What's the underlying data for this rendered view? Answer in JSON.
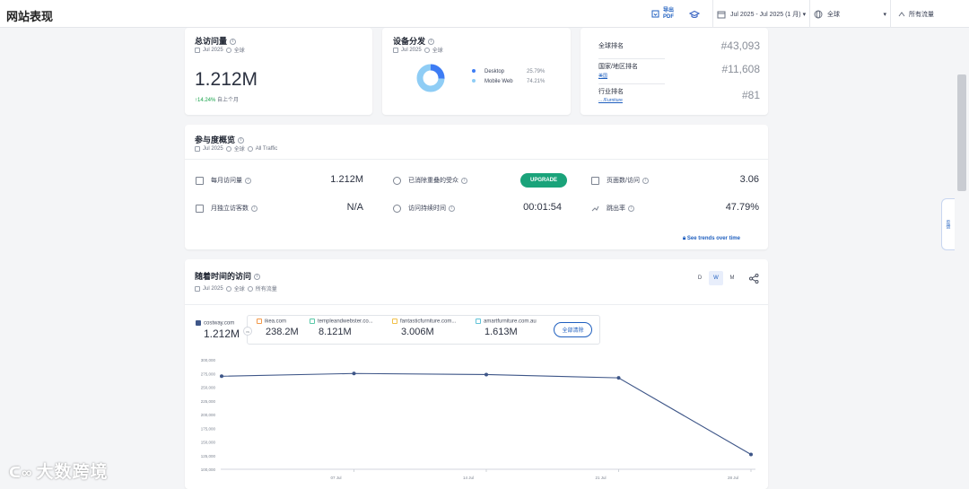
{
  "header": {
    "title": "网站表现",
    "pdf_label_1": "导出",
    "pdf_label_2": "PDF",
    "date_range": "Jul 2025 - Jul 2025 (1 月)",
    "geo": "全球",
    "traffic": "所有流量"
  },
  "visits_card": {
    "title": "总访问量",
    "period": "Jul 2025",
    "region": "全球",
    "value": "1.212M",
    "change": "↑14.24%",
    "change_suffix": "自上个月"
  },
  "device_card": {
    "title": "设备分发",
    "period": "Jul 2025",
    "region": "全球",
    "legend": [
      {
        "label": "Desktop",
        "value": "25.79%",
        "color": "#3d7cf4",
        "share": 25.79
      },
      {
        "label": "Mobile Web",
        "value": "74.21%",
        "color": "#8fcdf5",
        "share": 74.21
      }
    ]
  },
  "rank_card": {
    "global_label": "全球排名",
    "global_value": "#43,093",
    "country_label": "国家/地区排名",
    "country_sub": "美国",
    "country_value": "#11,608",
    "industry_label": "行业排名",
    "industry_sub": "... /Furniture",
    "industry_value": "#81"
  },
  "engagement": {
    "title": "参与度概览",
    "period": "Jul 2025",
    "region": "全球",
    "traffic": "All Traffic",
    "rows": [
      {
        "label": "每月访问量",
        "value": "1.212M"
      },
      {
        "label": "月独立访客数",
        "value": "N/A"
      },
      {
        "label": "已消除重叠的受众",
        "value": "UPGRADE"
      },
      {
        "label": "访问持续时间",
        "value": "00:01:54"
      },
      {
        "label": "页面数/访问",
        "value": "3.06"
      },
      {
        "label": "跳出率",
        "value": "47.79%"
      }
    ],
    "trends_link": "See trends over time"
  },
  "visits_over_time": {
    "title": "随着时间的访问",
    "period": "Jul 2025",
    "region": "全球",
    "traffic": "所有流量",
    "granularity": [
      "D",
      "W",
      "M"
    ],
    "granularity_active": "W",
    "primary": {
      "name": "costway.com",
      "value": "1.212M"
    },
    "vs_label": "vs",
    "competitors": [
      {
        "name": "ikea.com",
        "value": "238.2M",
        "color": "#f2994a"
      },
      {
        "name": "templeandwebster.co...",
        "value": "8.121M",
        "color": "#5ac8a8"
      },
      {
        "name": "fantasticfurniture.com...",
        "value": "3.006M",
        "color": "#f2c14a"
      },
      {
        "name": "amartfurniture.com.au",
        "value": "1.613M",
        "color": "#62c3d8"
      }
    ],
    "clear_all": "全部清除"
  },
  "chart_data": {
    "type": "line",
    "x_ticks": [
      "07 Jul",
      "14 Jul",
      "21 Jul",
      "28 Jul"
    ],
    "y_ticks": [
      "300,000",
      "275,000",
      "250,000",
      "225,000",
      "200,000",
      "175,000",
      "150,000",
      "125,000",
      "100,000"
    ],
    "ylim": [
      100000,
      300000
    ],
    "series": [
      {
        "name": "costway.com",
        "color": "#3e5688",
        "points": [
          {
            "x": "30 Jun",
            "y": 270000
          },
          {
            "x": "07 Jul",
            "y": 275000
          },
          {
            "x": "14 Jul",
            "y": 273000
          },
          {
            "x": "21 Jul",
            "y": 267000
          },
          {
            "x": "28 Jul",
            "y": 127000
          }
        ]
      }
    ],
    "grid": false
  },
  "side_tab": "反馈",
  "watermark": "大数跨境"
}
